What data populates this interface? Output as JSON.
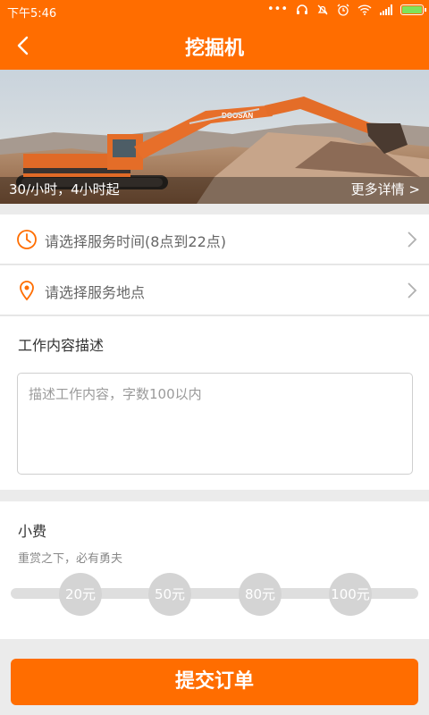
{
  "status_bar": {
    "time": "下午5:46",
    "icons": [
      "more-dots-icon",
      "headset-icon",
      "mute-icon",
      "alarm-icon",
      "wifi-icon",
      "signal-icon",
      "battery-icon"
    ]
  },
  "header": {
    "title": "挖掘机",
    "back_icon": "chevron-left-icon",
    "bg_color": "#ff6d00"
  },
  "banner": {
    "price_text": "30/小时，4小时起",
    "more_link": "更多详情 >",
    "machine_brand": "DOOSAN"
  },
  "form": {
    "time_row": {
      "label": "请选择服务时间(8点到22点)",
      "icon": "clock-icon"
    },
    "location_row": {
      "label": "请选择服务地点",
      "icon": "location-pin-icon"
    },
    "description": {
      "title": "工作内容描述",
      "placeholder": "描述工作内容，字数100以内",
      "value": ""
    },
    "tip": {
      "title": "小费",
      "subtitle": "重赏之下，必有勇夫",
      "options": [
        "20元",
        "50元",
        "80元",
        "100元"
      ]
    }
  },
  "submit": {
    "label": "提交订单"
  },
  "colors": {
    "accent": "#ff6d00",
    "background": "#ebebeb",
    "tip_chip": "#d4d4d4"
  }
}
